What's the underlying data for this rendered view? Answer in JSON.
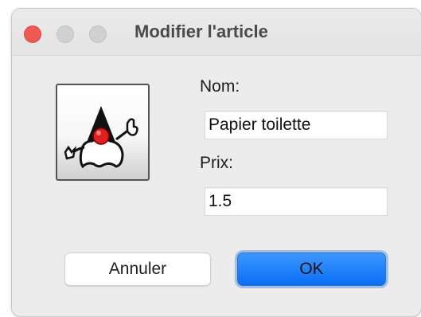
{
  "window": {
    "title": "Modifier l'article"
  },
  "form": {
    "icon": "java-duke-mascot-icon",
    "name_label": "Nom:",
    "name_value": "Papier toilette",
    "price_label": "Prix:",
    "price_value": "1.5"
  },
  "buttons": {
    "cancel_label": "Annuler",
    "ok_label": "OK"
  },
  "colors": {
    "close_button": "#ee5a52",
    "default_button": "#1a7cf7",
    "window_background": "#ececec"
  }
}
